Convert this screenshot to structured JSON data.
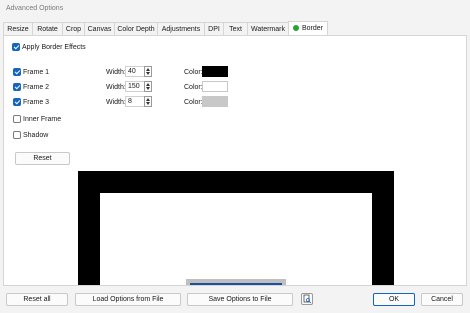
{
  "window": {
    "title": "Advanced Options"
  },
  "tabs": [
    {
      "label": "Resize"
    },
    {
      "label": "Rotate"
    },
    {
      "label": "Crop"
    },
    {
      "label": "Canvas"
    },
    {
      "label": "Color Depth"
    },
    {
      "label": "Adjustments"
    },
    {
      "label": "DPI"
    },
    {
      "label": "Text"
    },
    {
      "label": "Watermark"
    },
    {
      "label": "Border",
      "active": true
    }
  ],
  "border": {
    "apply_label": "Apply Border Effects",
    "apply_checked": true,
    "frames": [
      {
        "label": "Frame 1",
        "checked": true,
        "width_label": "Width:",
        "width": "40",
        "color_label": "Color:",
        "color": "#000000"
      },
      {
        "label": "Frame 2",
        "checked": true,
        "width_label": "Width:",
        "width": "150",
        "color_label": "Color:",
        "color": "#ffffff"
      },
      {
        "label": "Frame 3",
        "checked": true,
        "width_label": "Width:",
        "width": "8",
        "color_label": "Color:",
        "color": "#c8c8c8"
      }
    ],
    "inner_frame_label": "Inner Frame",
    "inner_frame_checked": false,
    "shadow_label": "Shadow",
    "shadow_checked": false,
    "reset_label": "Reset"
  },
  "footer": {
    "reset_all": "Reset all",
    "load_options": "Load Options from File",
    "save_options": "Save Options to File",
    "ok": "OK",
    "cancel": "Cancel"
  },
  "colors": {
    "accent": "#1565c0",
    "active_tab_dot": "#26a335",
    "preview_frame_outer": "#000000",
    "preview_frame_inner": "#ffffff",
    "preview_image_bar": "#1e4f9c"
  }
}
